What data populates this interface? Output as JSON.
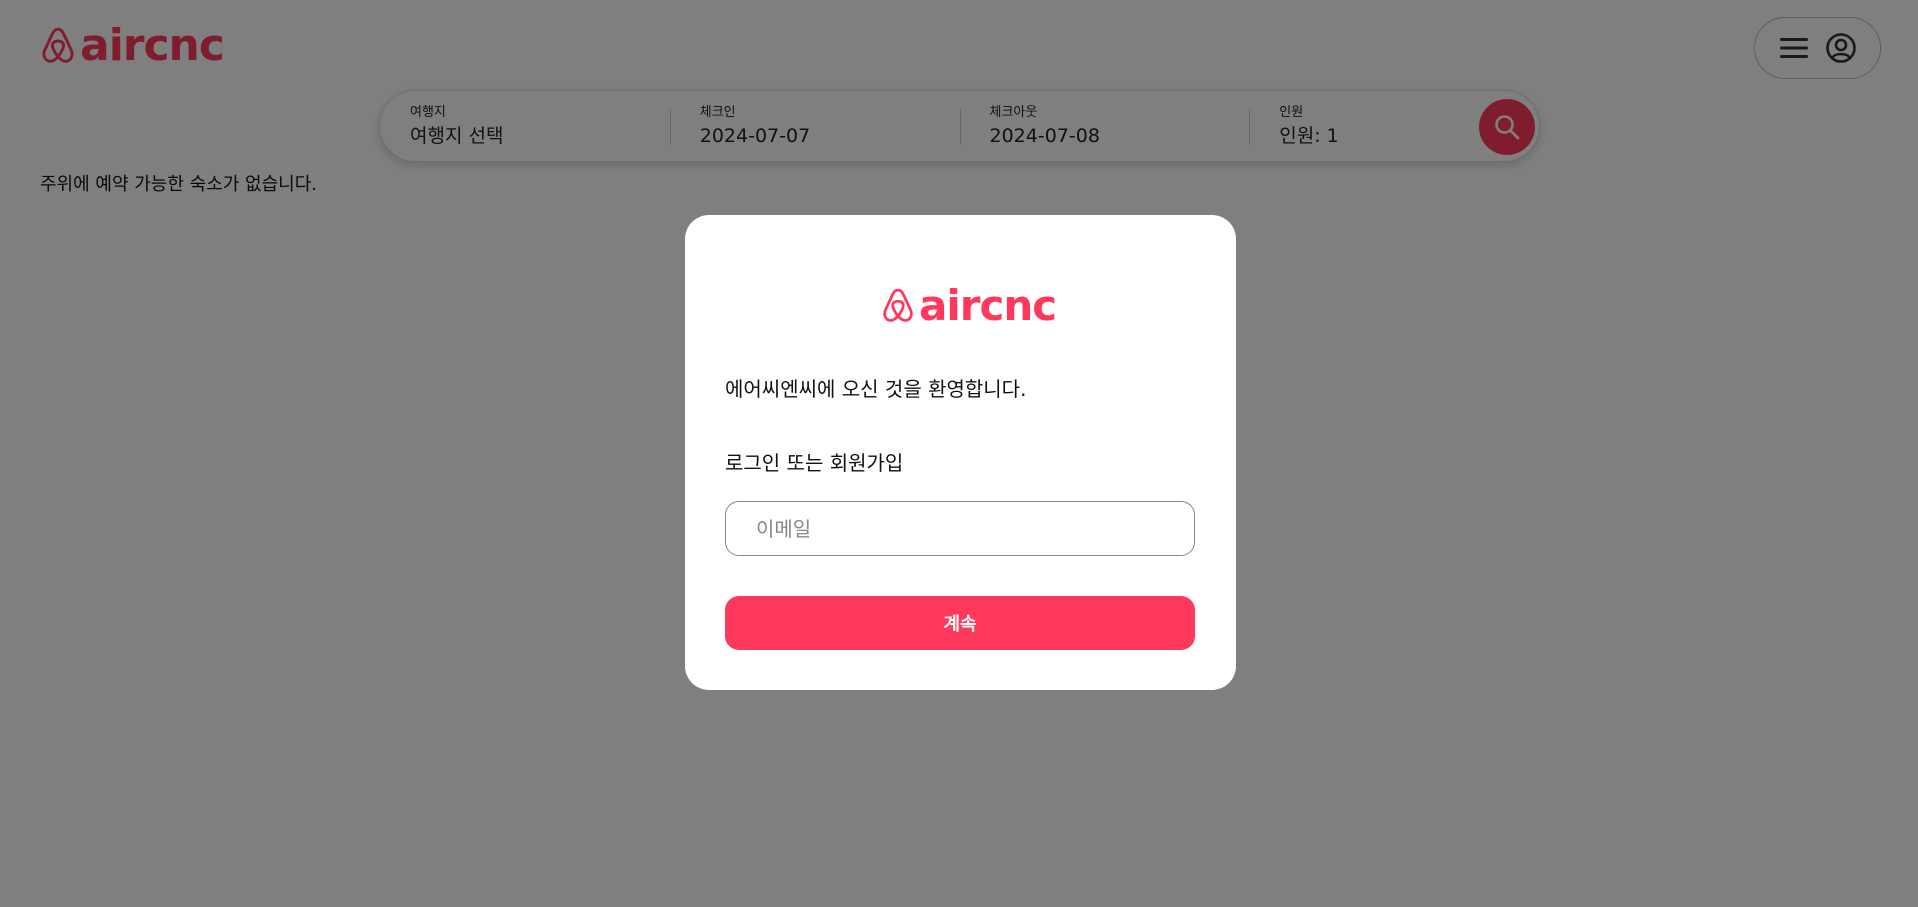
{
  "header": {
    "logo_text": "aircnc",
    "brand_color": "#ff385c",
    "menu_icon": "hamburger-icon",
    "user_icon": "user-circle-icon"
  },
  "search": {
    "destination": {
      "label": "여행지",
      "value": "여행지 선택"
    },
    "checkin": {
      "label": "체크인",
      "value": "2024-07-07"
    },
    "checkout": {
      "label": "체크아웃",
      "value": "2024-07-08"
    },
    "guests": {
      "label": "인원",
      "value": "인원: 1"
    },
    "button_icon": "search-icon"
  },
  "main": {
    "empty_message": "주위에 예약 가능한 숙소가 없습니다."
  },
  "modal": {
    "logo_text": "aircnc",
    "welcome": "에어씨엔씨에 오신 것을 환영합니다.",
    "subtitle": "로그인 또는 회원가입",
    "email_placeholder": "이메일",
    "email_value": "",
    "continue_label": "계속"
  }
}
